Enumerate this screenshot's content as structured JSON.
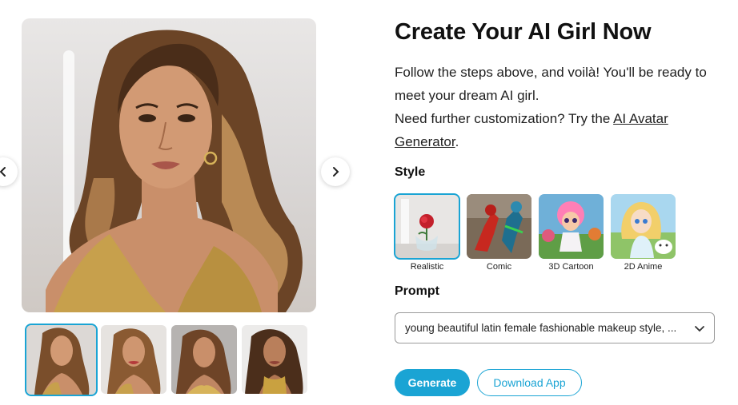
{
  "gallery": {
    "prev_icon": "chevron-left-icon",
    "next_icon": "chevron-right-icon",
    "thumbnail_count": 4,
    "selected_thumbnail": 1
  },
  "content": {
    "title": "Create Your AI Girl Now",
    "desc_line1": "Follow the steps above, and voilà! You'll be ready to meet your dream AI girl.",
    "desc_line2_prefix": "Need further customization? Try the ",
    "desc_link": "AI Avatar Generator",
    "desc_line2_suffix": "."
  },
  "style": {
    "label": "Style",
    "options": [
      {
        "label": "Realistic",
        "selected": true
      },
      {
        "label": "Comic",
        "selected": false
      },
      {
        "label": "3D Cartoon",
        "selected": false
      },
      {
        "label": "2D Anime",
        "selected": false
      }
    ]
  },
  "prompt": {
    "label": "Prompt",
    "value": "young beautiful latin female fashionable makeup style, ..."
  },
  "actions": {
    "generate_label": "Generate",
    "download_label": "Download App"
  },
  "colors": {
    "accent": "#1aa4d4",
    "text": "#111111",
    "border": "#9a9a9a"
  }
}
